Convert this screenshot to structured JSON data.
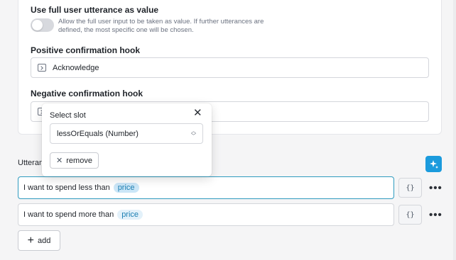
{
  "settings": {
    "full_utterance": {
      "label": "Use full user utterance as value",
      "help": "Allow the full user input to be taken as value. If further utterances are defined, the most specific one will be chosen.",
      "enabled": false
    },
    "positive_hook": {
      "label": "Positive confirmation hook",
      "value": "Acknowledge",
      "icon": "terminal-icon"
    },
    "negative_hook": {
      "label": "Negative confirmation hook",
      "value": "",
      "icon": "terminal-icon"
    }
  },
  "utterances": {
    "label": "Utterances",
    "label_visible": "Utteran",
    "rows": [
      {
        "text": "I want to spend less than",
        "slot": "price",
        "focused": true,
        "slot_selected": true
      },
      {
        "text": "I want to spend more than",
        "slot": "price",
        "focused": false,
        "slot_selected": false
      }
    ],
    "braces_label": "{}",
    "more_label": "•••",
    "add_label": "add",
    "magic_icon": "sparkle-icon"
  },
  "popover": {
    "title": "Select slot",
    "selected_slot": "lessOrEquals (Number)",
    "remove_label": "remove",
    "close_icon": "close-icon"
  },
  "colors": {
    "accent": "#1b9bdd",
    "chip_bg": "#e3f1fa",
    "chip_text": "#1d7fb3",
    "focus_border": "#2f9bbf"
  }
}
